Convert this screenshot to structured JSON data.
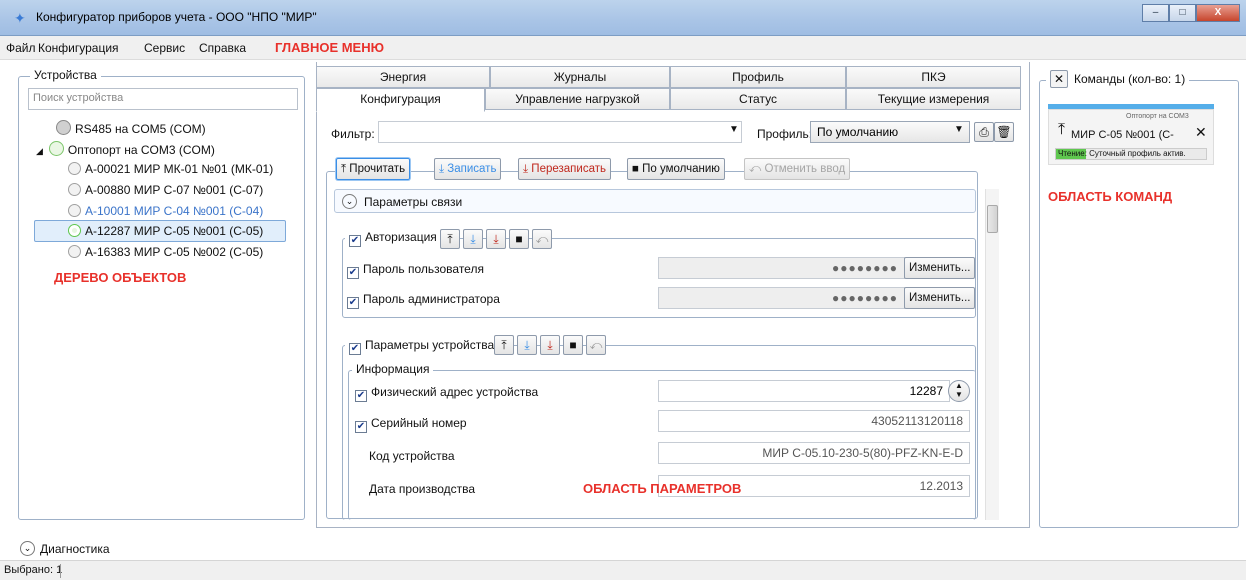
{
  "window": {
    "title": "Конфигуратор приборов учета - ООО \"НПО \"МИР\"",
    "min": "–",
    "max": "□",
    "close": "X"
  },
  "menu": {
    "items": [
      "Файл",
      "Конфигурация",
      "Сервис",
      "Справка"
    ],
    "annotation": "ГЛАВНОЕ МЕНЮ"
  },
  "devices": {
    "title": "Устройства",
    "search_placeholder": "Поиск устройства",
    "tree": [
      {
        "label": "RS485 на COM5  (COM)"
      },
      {
        "label": "Оптопорт на COM3  (COM)"
      },
      {
        "label": "А-00021  МИР МК-01 №01  (МК-01)"
      },
      {
        "label": "А-00880  МИР С-07 №001  (С-07)"
      },
      {
        "label": "А-10001  МИР С-04 №001  (С-04)"
      },
      {
        "label": "А-12287  МИР С-05 №001  (С-05)"
      },
      {
        "label": "А-16383  МИР С-05 №002  (С-05)"
      }
    ],
    "annotation": "ДЕРЕВО ОБЪЕКТОВ"
  },
  "tabs": {
    "row1": [
      "Энергия",
      "Журналы",
      "Профиль",
      "ПКЭ"
    ],
    "row2": [
      "Конфигурация",
      "Управление нагрузкой",
      "Статус",
      "Текущие измерения"
    ]
  },
  "filter": {
    "label": "Фильтр:",
    "value": "",
    "profile_label": "Профиль:",
    "profile_value": "По умолчанию"
  },
  "toolbar": {
    "read": "Прочитать",
    "write": "Записать",
    "rewrite": "Перезаписать",
    "default": "По умолчанию",
    "cancel": "Отменить ввод"
  },
  "sections": {
    "comm": "Параметры связи",
    "auth": {
      "title": "Авторизация",
      "user_pwd": "Пароль пользователя",
      "admin_pwd": "Пароль администратора",
      "pwd_mask": "●●●●●●●●",
      "change": "Изменить..."
    },
    "device": {
      "title": "Параметры устройства",
      "info": "Информация",
      "rows": [
        {
          "label": "Физический адрес устройства",
          "value": "12287"
        },
        {
          "label": "Серийный номер",
          "value": "43052113120118"
        },
        {
          "label": "Код устройства",
          "value": "МИР С-05.10-230-5(80)-PFZ-KN-E-D"
        },
        {
          "label": "Дата производства",
          "value": "12.2013"
        }
      ]
    }
  },
  "params_annotation": "ОБЛАСТЬ ПАРАМЕТРОВ",
  "commands": {
    "title": "Команды (кол-во: 1)",
    "card_port": "Оптопорт на COM3",
    "card_device": "МИР С-05 №001 (С-",
    "card_status": "Чтение: Суточный профиль актив.",
    "annotation": "ОБЛАСТЬ КОМАНД"
  },
  "diagnostics": "Диагностика",
  "status": {
    "selected": "Выбрано: 1"
  },
  "colors": {
    "accent": "#3a8ee6",
    "annotation": "#e8312b",
    "link": "#3b74c9",
    "green": "#5fc74f"
  }
}
